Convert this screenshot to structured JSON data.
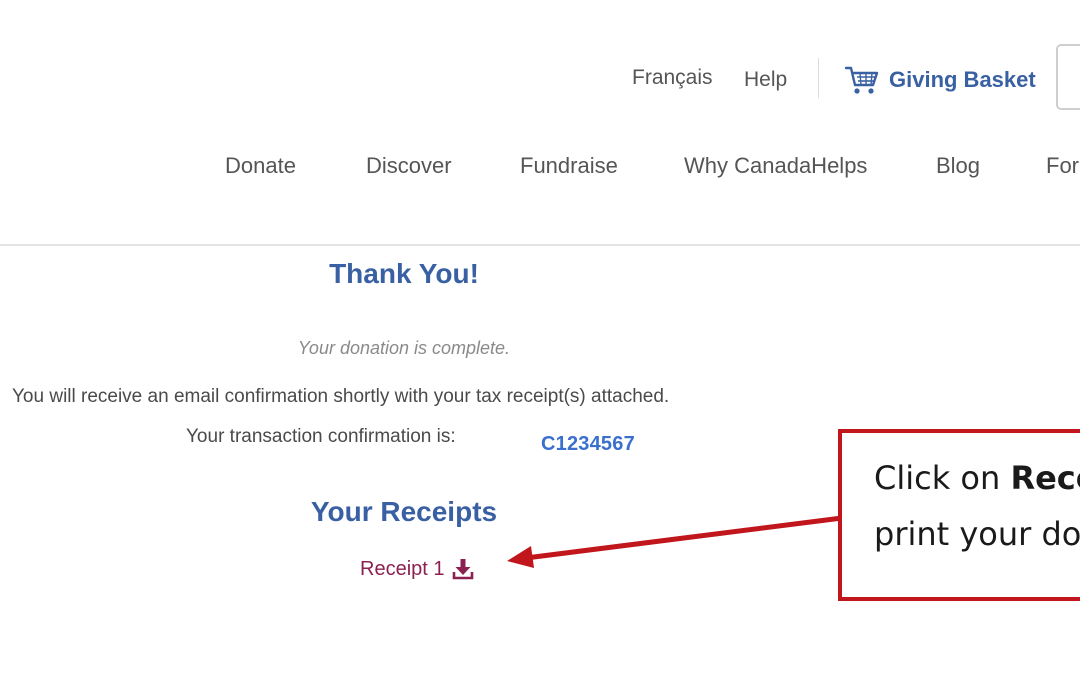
{
  "topbar": {
    "language_link": "Français",
    "help_link": "Help",
    "giving_basket": "Giving Basket"
  },
  "nav": {
    "items": [
      "Donate",
      "Discover",
      "Fundraise",
      "Why CanadaHelps",
      "Blog",
      "For"
    ]
  },
  "main": {
    "thank_you": "Thank You!",
    "status": "Your donation is complete.",
    "email_notice": "You will receive an email confirmation shortly with your tax receipt(s) attached.",
    "confirmation_label": "Your transaction confirmation is:",
    "confirmation_number": "C1234567",
    "receipts_heading": "Your Receipts",
    "receipt_link": "Receipt 1"
  },
  "callout": {
    "line1_prefix": "Click on ",
    "line1_bold": "Rece",
    "line2": "print your do"
  },
  "colors": {
    "brand_blue": "#3a60a4",
    "confirmation_blue": "#3a6fcf",
    "receipt_link": "#8c2050",
    "callout_red": "#c0161c"
  },
  "icons": {
    "basket": "shopping-cart-icon",
    "receipt": "download-icon"
  }
}
